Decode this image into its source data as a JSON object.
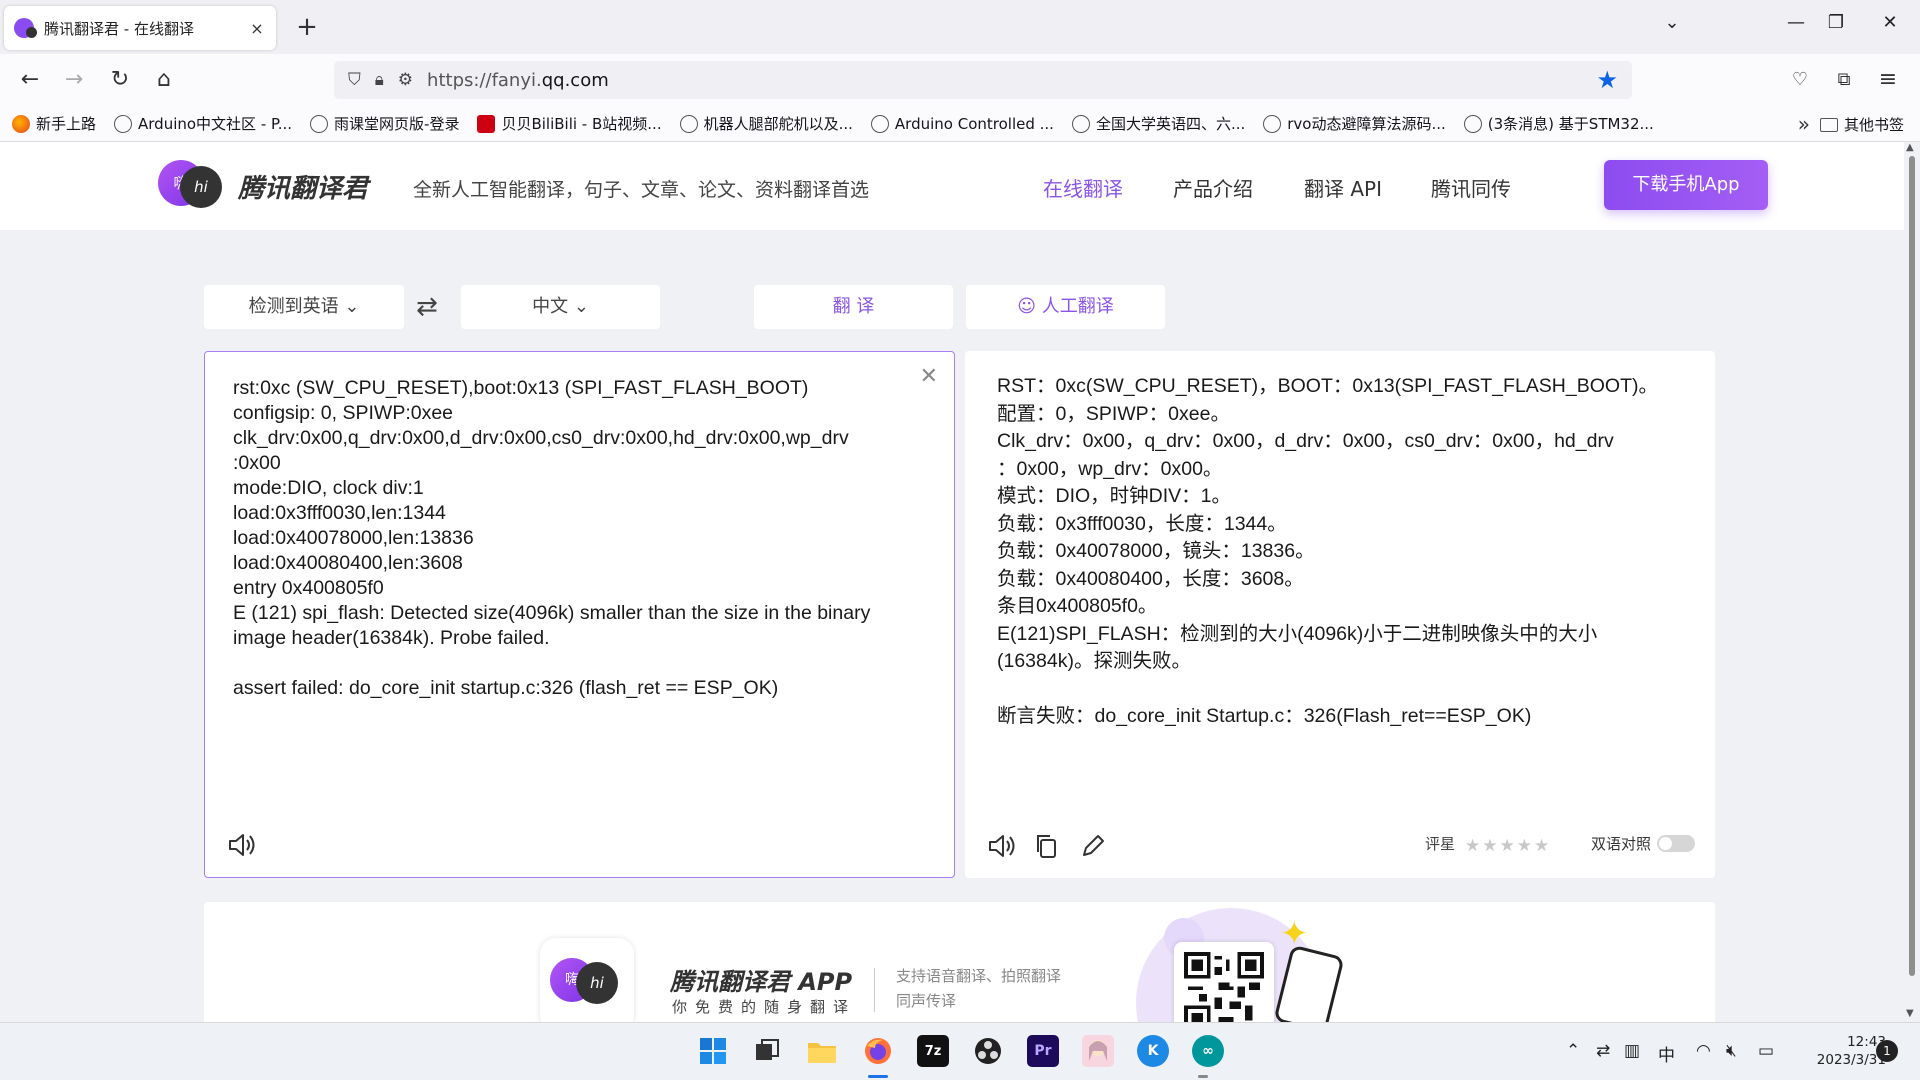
{
  "browser": {
    "tab_title": "腾讯翻译君 - 在线翻译",
    "tab_close": "×",
    "new_tab": "+",
    "url_prefix": "https://fanyi.",
    "url_domain": "qq.com",
    "bookmarks": [
      {
        "label": "新手上路",
        "icon": "firefox-icon"
      },
      {
        "label": "Arduino中文社区 - P...",
        "icon": "globe-icon"
      },
      {
        "label": "雨课堂网页版-登录",
        "icon": "globe-icon"
      },
      {
        "label": "贝贝BiliBili - B站视频...",
        "icon": "bilibili-icon"
      },
      {
        "label": "机器人腿部舵机以及...",
        "icon": "globe-icon"
      },
      {
        "label": "Arduino Controlled ...",
        "icon": "globe-icon"
      },
      {
        "label": "全国大学英语四、六...",
        "icon": "globe-icon"
      },
      {
        "label": "rvo动态避障算法源码...",
        "icon": "globe-icon"
      },
      {
        "label": "(3条消息) 基于STM32...",
        "icon": "globe-icon"
      }
    ],
    "other_bookmarks": "其他书签"
  },
  "site": {
    "logo_left": "嗨",
    "logo_right": "hi",
    "brand": "腾讯翻译君",
    "slogan": "全新人工智能翻译，句子、文章、论文、资料翻译首选",
    "nav": [
      "在线翻译",
      "产品介绍",
      "翻译 API",
      "腾讯同传"
    ],
    "download_btn": "下载手机App",
    "accent_color": "#8a55e8"
  },
  "translator": {
    "source_lang": "检测到英语 ⌄",
    "target_lang": "中文 ⌄",
    "translate_btn": "翻 译",
    "human_btn": "人工翻译",
    "source_text": "rst:0xc (SW_CPU_RESET),boot:0x13 (SPI_FAST_FLASH_BOOT)\nconfigsip: 0, SPIWP:0xee\nclk_drv:0x00,q_drv:0x00,d_drv:0x00,cs0_drv:0x00,hd_drv:0x00,wp_drv\n:0x00\nmode:DIO, clock div:1\nload:0x3fff0030,len:1344\nload:0x40078000,len:13836\nload:0x40080400,len:3608\nentry 0x400805f0\nE (121) spi_flash: Detected size(4096k) smaller than the size in the binary image header(16384k). Probe failed.\n\nassert failed: do_core_init startup.c:326 (flash_ret == ESP_OK)",
    "target_text": "RST：0xc(SW_CPU_RESET)，BOOT：0x13(SPI_FAST_FLASH_BOOT)。\n配置：0，SPIWP：0xee。\nClk_drv：0x00，q_drv：0x00，d_drv：0x00，cs0_drv：0x00，hd_drv\n：0x00，wp_drv：0x00。\n模式：DIO，时钟DIV：1。\n负载：0x3fff0030，长度：1344。\n负载：0x40078000，镜头：13836。\n负载：0x40080400，长度：3608。\n条目0x400805f0。\nE(121)SPI_FLASH：检测到的大小(4096k)小于二进制映像头中的大小(16384k)。探测失败。\n\n断言失败：do_core_init Startup.c：326(Flash_ret==ESP_OK)",
    "rating_label": "评星",
    "rating_stars": "★★★★★",
    "bilingual_label": "双语对照",
    "bilingual_on": false
  },
  "promo": {
    "title": "腾讯翻译君 APP",
    "subtitle": "你免费的随身翻译",
    "desc_line1": "支持语音翻译、拍照翻译",
    "desc_line2": "同声传译"
  },
  "taskbar": {
    "ime": "中",
    "time": "12:43",
    "date": "2023/3/31",
    "notifications": "1",
    "apps": [
      {
        "name": "start-icon"
      },
      {
        "name": "taskview-icon"
      },
      {
        "name": "file-explorer-icon"
      },
      {
        "name": "firefox-icon"
      },
      {
        "name": "7zip-icon",
        "text": "7z"
      },
      {
        "name": "obs-icon"
      },
      {
        "name": "premiere-icon",
        "text": "Pr"
      },
      {
        "name": "anime-app-icon"
      },
      {
        "name": "kugou-icon",
        "text": "K"
      },
      {
        "name": "arduino-icon",
        "text": "∞"
      }
    ]
  }
}
